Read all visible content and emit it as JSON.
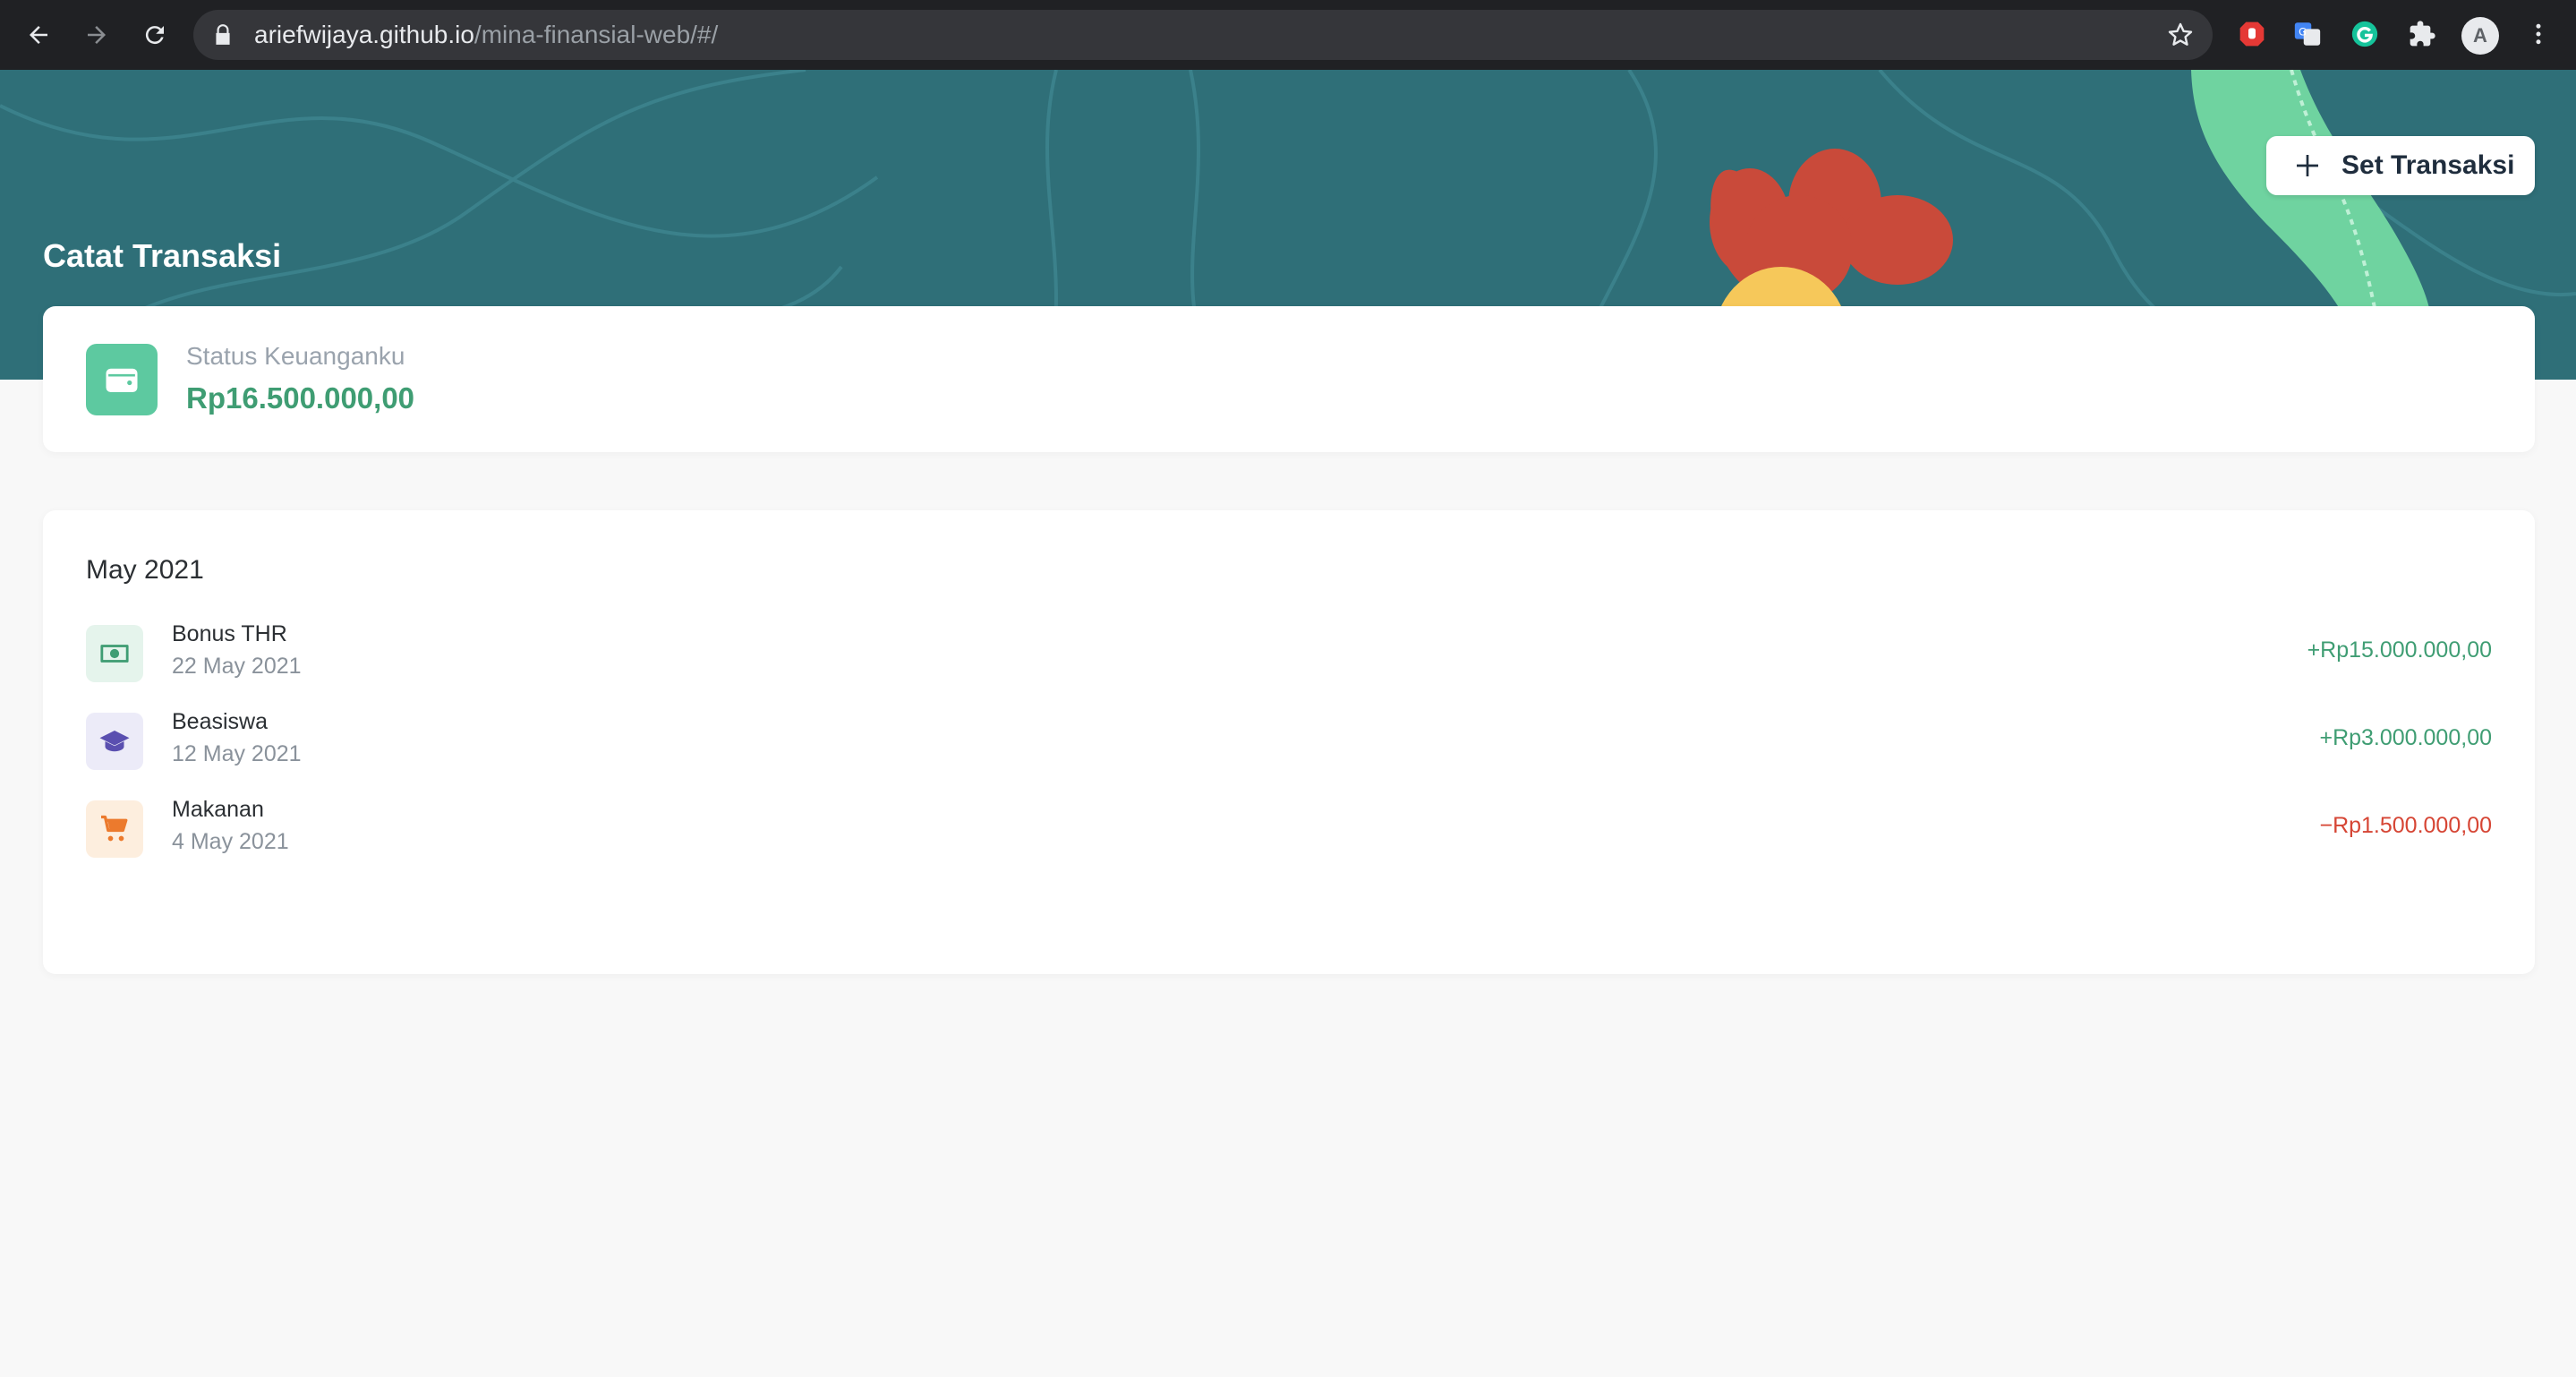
{
  "browser": {
    "url_host": "ariefwijaya.github.io",
    "url_path": "/mina-finansial-web/#/",
    "profile_initial": "A"
  },
  "header": {
    "title": "Catat Transaksi",
    "set_button_label": "Set Transaksi"
  },
  "status": {
    "label": "Status Keuanganku",
    "amount": "Rp16.500.000,00"
  },
  "transactions": {
    "month": "May 2021",
    "items": [
      {
        "name": "Bonus THR",
        "date": "22 May 2021",
        "amount": "+Rp15.000.000,00",
        "icon": "money-icon",
        "type": "income"
      },
      {
        "name": "Beasiswa",
        "date": "12 May 2021",
        "amount": "+Rp3.000.000,00",
        "icon": "graduation-cap-icon",
        "type": "income"
      },
      {
        "name": "Makanan",
        "date": "4 May 2021",
        "amount": "−Rp1.500.000,00",
        "icon": "cart-icon",
        "type": "expense"
      }
    ]
  },
  "colors": {
    "hero": "#2f6f78",
    "income": "#3f9d73",
    "expense": "#d64534",
    "wallet": "#5dc9a0"
  }
}
